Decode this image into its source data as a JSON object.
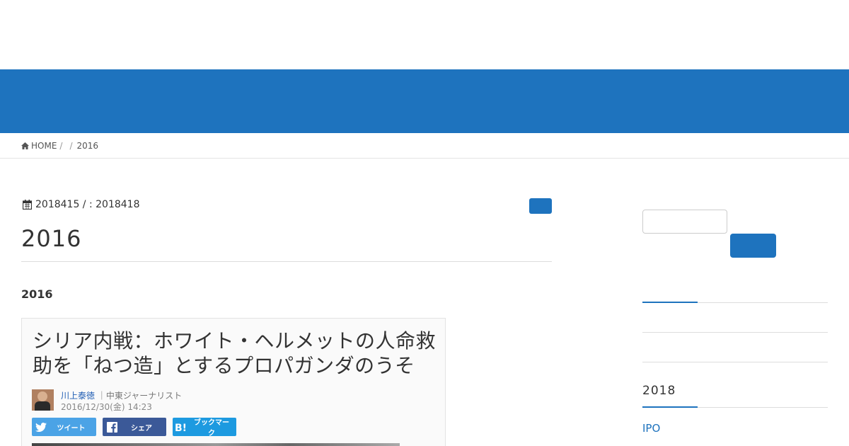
{
  "breadcrumb": {
    "home_label": "HOME",
    "sep1": "/",
    "sep2": "/",
    "current": "2016"
  },
  "post": {
    "meta_text": "2018415 / :  2018418",
    "title": "2016",
    "subheading": "2016"
  },
  "embed": {
    "headline": "シリア内戦：ホワイト・ヘルメットの人命救助を「ねつ造」とするプロパガンダのうそ",
    "author_name": "川上泰徳",
    "author_role": "｜中東ジャーナリスト",
    "date": "2016/12/30(金) 14:23",
    "share_tweet": "ツイート",
    "share_facebook": "シェア",
    "share_hatena": "ブックマーク"
  },
  "sidebar": {
    "archive_title": "2018",
    "link_1": "IPO"
  },
  "colors": {
    "brand_blue": "#1e73be",
    "twitter": "#4ba3e6",
    "facebook": "#3b5998",
    "hatena": "#1d9ae0"
  },
  "icons": [
    "home-icon",
    "calendar-icon",
    "twitter-icon",
    "facebook-icon",
    "hatena-icon"
  ]
}
